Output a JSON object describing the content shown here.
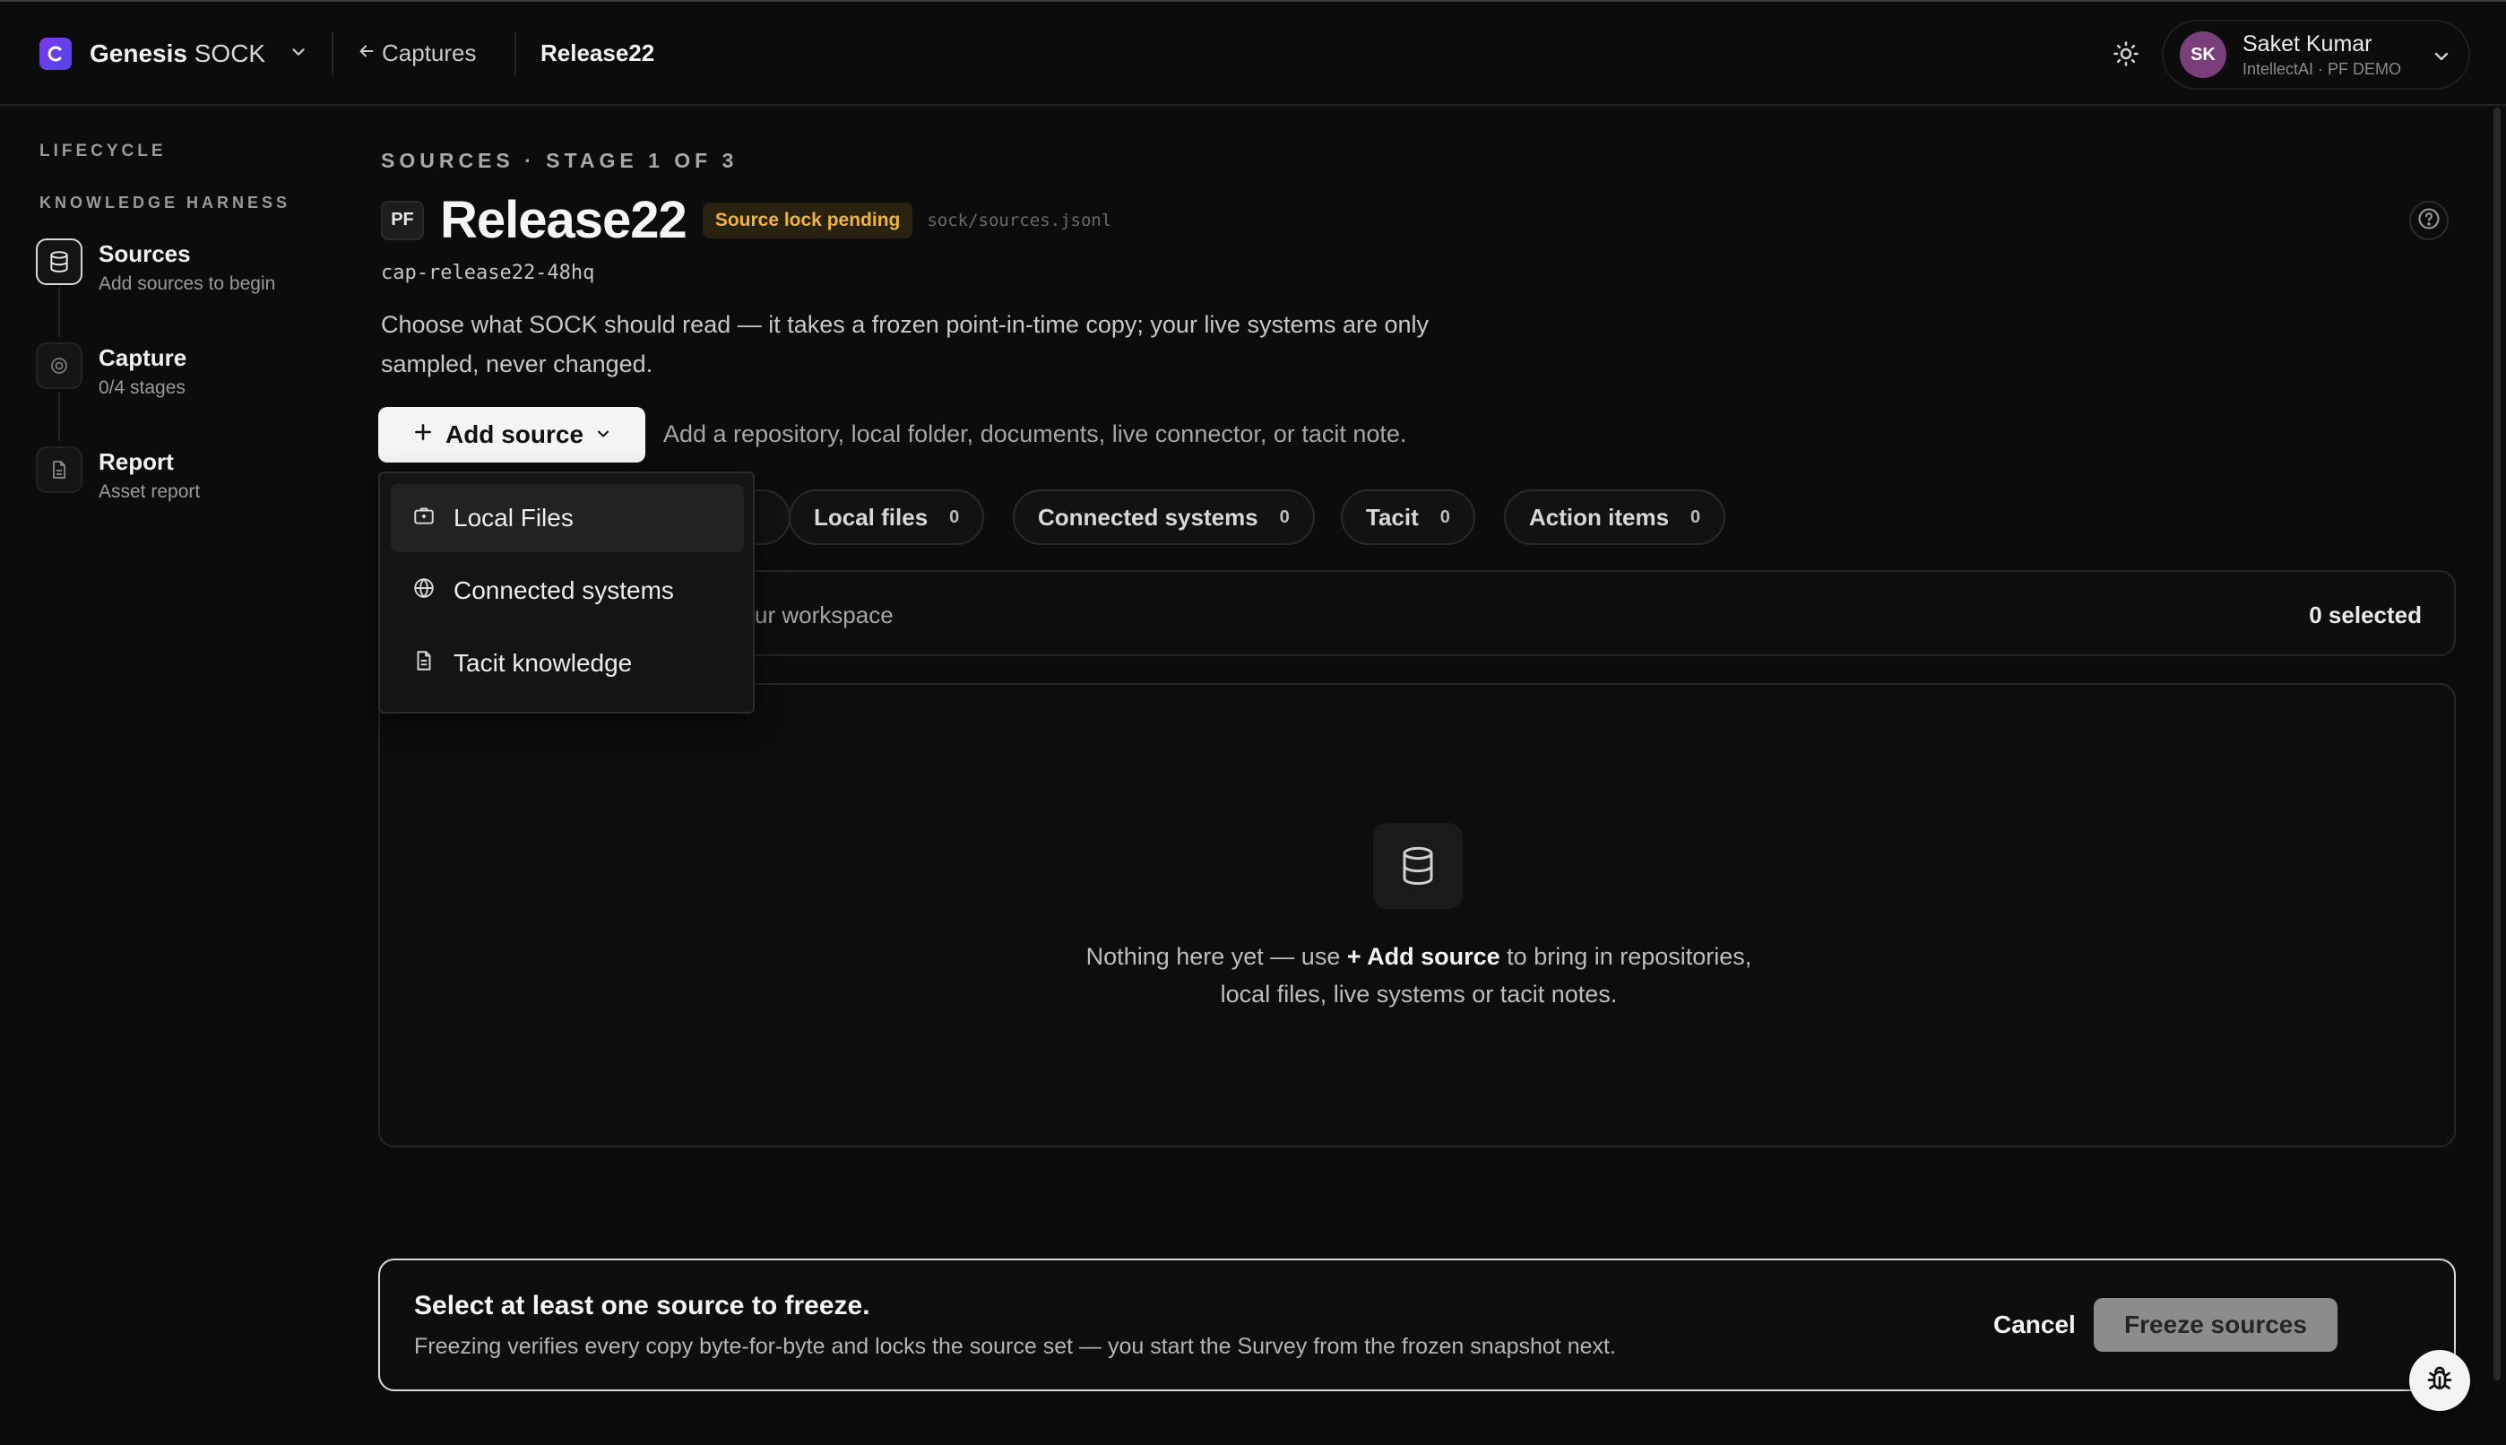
{
  "header": {
    "brand_bold": "Genesis",
    "brand_light": "SOCK",
    "back_label": "Captures",
    "current_crumb": "Release22",
    "user": {
      "initials": "SK",
      "name": "Saket Kumar",
      "org": "IntellectAI · PF DEMO"
    }
  },
  "sidebar": {
    "section_lifecycle": "LIFECYCLE",
    "section_harness": "KNOWLEDGE HARNESS",
    "items": [
      {
        "label": "Sources",
        "sub": "Add sources to begin",
        "icon": "database-icon"
      },
      {
        "label": "Capture",
        "sub": "0/4 stages",
        "icon": "target-icon"
      },
      {
        "label": "Report",
        "sub": "Asset report",
        "icon": "document-icon"
      }
    ]
  },
  "main": {
    "eyebrow": "SOURCES · STAGE 1 OF 3",
    "badge": "PF",
    "title": "Release22",
    "lock_status": "Source lock pending",
    "path": "sock/sources.jsonl",
    "capture_id": "cap-release22-48hq",
    "description": "Choose what SOCK should read — it takes a frozen point-in-time copy; your live systems are only sampled, never changed.",
    "add_source_label": "Add source",
    "add_source_hint": "Add a repository, local folder, documents, live connector, or tacit note.",
    "filters": [
      {
        "label": "Local files",
        "count": "0"
      },
      {
        "label": "Connected systems",
        "count": "0"
      },
      {
        "label": "Tacit",
        "count": "0"
      },
      {
        "label": "Action items",
        "count": "0"
      }
    ],
    "selection_text": "d to your workspace",
    "selected_count": "0 selected",
    "empty_pre": "Nothing here yet — use",
    "empty_bold": "+ Add source",
    "empty_post": "to bring in repositories,",
    "empty_line2": "local files, live systems or tacit notes."
  },
  "dropdown": {
    "items": [
      {
        "label": "Local Files",
        "icon": "briefcase-icon"
      },
      {
        "label": "Connected systems",
        "icon": "globe-icon"
      },
      {
        "label": "Tacit knowledge",
        "icon": "document-icon"
      }
    ]
  },
  "footer": {
    "title": "Select at least one source to freeze.",
    "subtitle": "Freezing verifies every copy byte-for-byte and locks the source set — you start the Survey from the frozen snapshot next.",
    "cancel": "Cancel",
    "freeze": "Freeze sources"
  },
  "colors": {
    "background": "#0c0c0c",
    "lock_badge_text": "#f0b43c",
    "avatar": "#7a3f7a",
    "brand_accent": "#7c3aed"
  }
}
